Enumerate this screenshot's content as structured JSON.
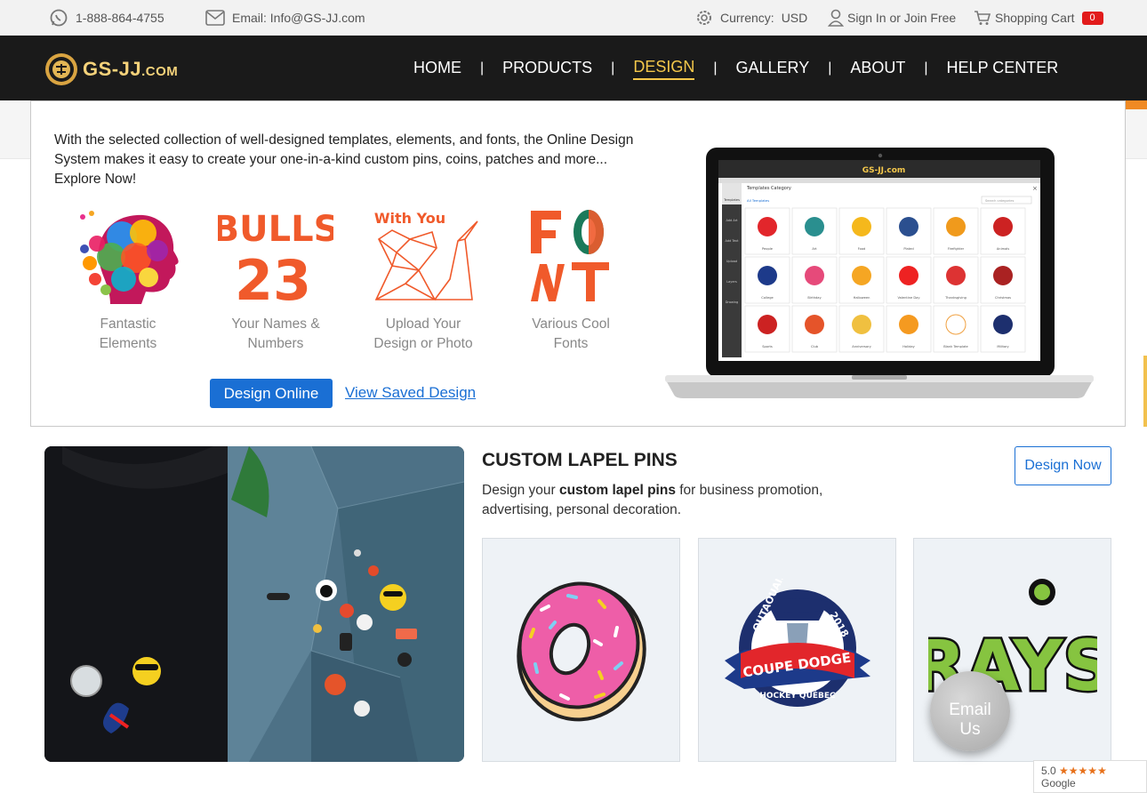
{
  "topbar": {
    "phone": "1-888-864-4755",
    "email": "Email: Info@GS-JJ.com",
    "currency_label": "Currency:",
    "currency_value": "USD",
    "sign_in": "Sign In or Join Free",
    "cart_label": "Shopping Cart",
    "cart_count": "0"
  },
  "logo": {
    "main": "GS-JJ",
    "suffix": ".COM"
  },
  "nav": {
    "items": [
      "HOME",
      "PRODUCTS",
      "DESIGN",
      "GALLERY",
      "ABOUT",
      "HELP CENTER"
    ],
    "separator": "|",
    "active": "DESIGN"
  },
  "design_menu": {
    "intro": "With the selected collection of well-designed templates, elements, and fonts, the Online Design System makes it easy to create your one-in-a-kind custom pins, coins, patches and more... Explore Now!",
    "features": [
      {
        "line1": "Fantastic",
        "line2": "Elements",
        "icon": "colorful-head-icon"
      },
      {
        "line1": "Your Names &",
        "line2": "Numbers",
        "icon": "bulls-23-icon",
        "art_top": "BULLS",
        "art_bottom": "23"
      },
      {
        "line1": "Upload Your",
        "line2": "Design or Photo",
        "icon": "origami-cat-icon",
        "art_top": "With You"
      },
      {
        "line1": "Various Cool",
        "line2": "Fonts",
        "icon": "font-letters-icon"
      }
    ],
    "design_online_button": "Design Online",
    "view_saved_link": "View Saved Design",
    "laptop": {
      "brand": "GS-JJ.com",
      "panel_title": "Templates Category",
      "tab": "All Templates",
      "search_placeholder": "Search categories",
      "sidebar": [
        "Templates",
        "Add Art",
        "Add Text",
        "Upload",
        "Layers",
        "Drawing"
      ],
      "templates": [
        "People",
        "Art",
        "Food",
        "Plated",
        "Firefighter",
        "Animals",
        "College",
        "Birthday",
        "Halloween",
        "Valentine Day",
        "Thanksgiving",
        "Christmas",
        "Sports",
        "Club",
        "Anniversary",
        "Holiday",
        "Blank Template",
        "Military"
      ]
    }
  },
  "lapel_section": {
    "title": "CUSTOM LAPEL PINS",
    "desc_prefix": "Design your ",
    "desc_bold": "custom lapel pins",
    "desc_suffix": " for business promotion, advertising, personal decoration.",
    "design_now_button": "Design Now",
    "cards": [
      {
        "name": "donut-pin"
      },
      {
        "name": "coupe-dodge-pin",
        "arc_top": "OUTAOUAIS",
        "year": "2018",
        "ribbon": "COUPE DODGE",
        "bottom": "HOCKEY QUÉBEC"
      },
      {
        "name": "rays-pin",
        "text": "RAYS"
      }
    ]
  },
  "floating": {
    "email_us_line1": "Email",
    "email_us_line2": "Us",
    "google_rating": "5.0",
    "google_stars": "★★★★★",
    "google_label": "Google"
  },
  "colors": {
    "nav_bg": "#1a1a1a",
    "accent_gold": "#f5c84b",
    "link_blue": "#1a6fd4",
    "cart_badge": "#e21b1b"
  }
}
